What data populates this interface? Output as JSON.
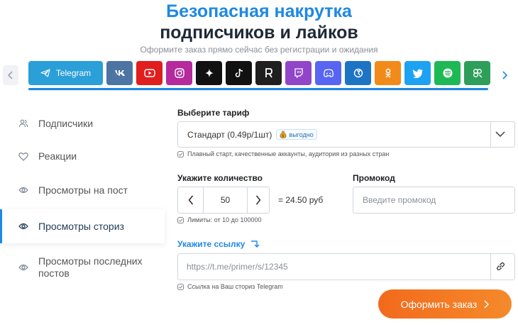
{
  "header": {
    "title_line1": "Безопасная накрутка",
    "title_line2": "подписчиков и лайков",
    "subtitle": "Оформите заказ прямо сейчас без регистрации и ожидания"
  },
  "platforms": [
    {
      "name": "Telegram",
      "icon": "telegram-icon",
      "color": "#2a9fd8",
      "active": true
    },
    {
      "name": "VK",
      "icon": "vk-icon",
      "color": "#4c75a3"
    },
    {
      "name": "YouTube",
      "icon": "youtube-icon",
      "color": "#e01e1e"
    },
    {
      "name": "Instagram",
      "icon": "instagram-icon",
      "color": "#b52a9c"
    },
    {
      "name": "Threads",
      "icon": "sparkle-icon",
      "color": "#111111"
    },
    {
      "name": "TikTok",
      "icon": "tiktok-icon",
      "color": "#111111"
    },
    {
      "name": "Rutube",
      "icon": "rutube-icon",
      "color": "#1f1f1f"
    },
    {
      "name": "Twitch",
      "icon": "twitch-icon",
      "color": "#9146c9"
    },
    {
      "name": "Discord",
      "icon": "discord-icon",
      "color": "#5865f2"
    },
    {
      "name": "Likee",
      "icon": "likee-icon",
      "color": "#1e74c4"
    },
    {
      "name": "Odnoklassniki",
      "icon": "ok-icon",
      "color": "#f28a1a"
    },
    {
      "name": "Twitter",
      "icon": "twitter-icon",
      "color": "#1da1f2"
    },
    {
      "name": "Spotify",
      "icon": "spotify-icon",
      "color": "#1db954"
    },
    {
      "name": "Other",
      "icon": "clover-icon",
      "color": "#2e9e5b"
    }
  ],
  "platform_active_label": "Telegram",
  "sidebar": {
    "items": [
      {
        "label": "Подписчики",
        "icon": "users-icon"
      },
      {
        "label": "Реакции",
        "icon": "heart-icon"
      },
      {
        "label": "Просмотры на пост",
        "icon": "eye-icon"
      },
      {
        "label": "Просмотры сториз",
        "icon": "eye-icon",
        "active": true
      },
      {
        "label": "Просмотры последних постов",
        "icon": "eye-icon"
      }
    ]
  },
  "form": {
    "tariff_label": "Выберите тариф",
    "tariff_value": "Стандарт (0.49р/1шт)",
    "tariff_badge": "выгодно",
    "tariff_hint": "Плавный старт, качественные аккаунты, аудитория из разных стран",
    "quantity_label": "Укажите количество",
    "quantity_value": "50",
    "quantity_total": "= 24.50 руб",
    "quantity_hint": "Лимиты: от 10 до 100000",
    "promo_label": "Промокод",
    "promo_placeholder": "Введите промокод",
    "link_label": "Укажите ссылку",
    "link_placeholder": "https://t.me/primer/s/12345",
    "link_hint": "Ссылка на Ваш сториз Telegram",
    "order_button": "Оформить заказ"
  },
  "colors": {
    "accent": "#1e88e5",
    "order_button": "#f26a1c"
  }
}
